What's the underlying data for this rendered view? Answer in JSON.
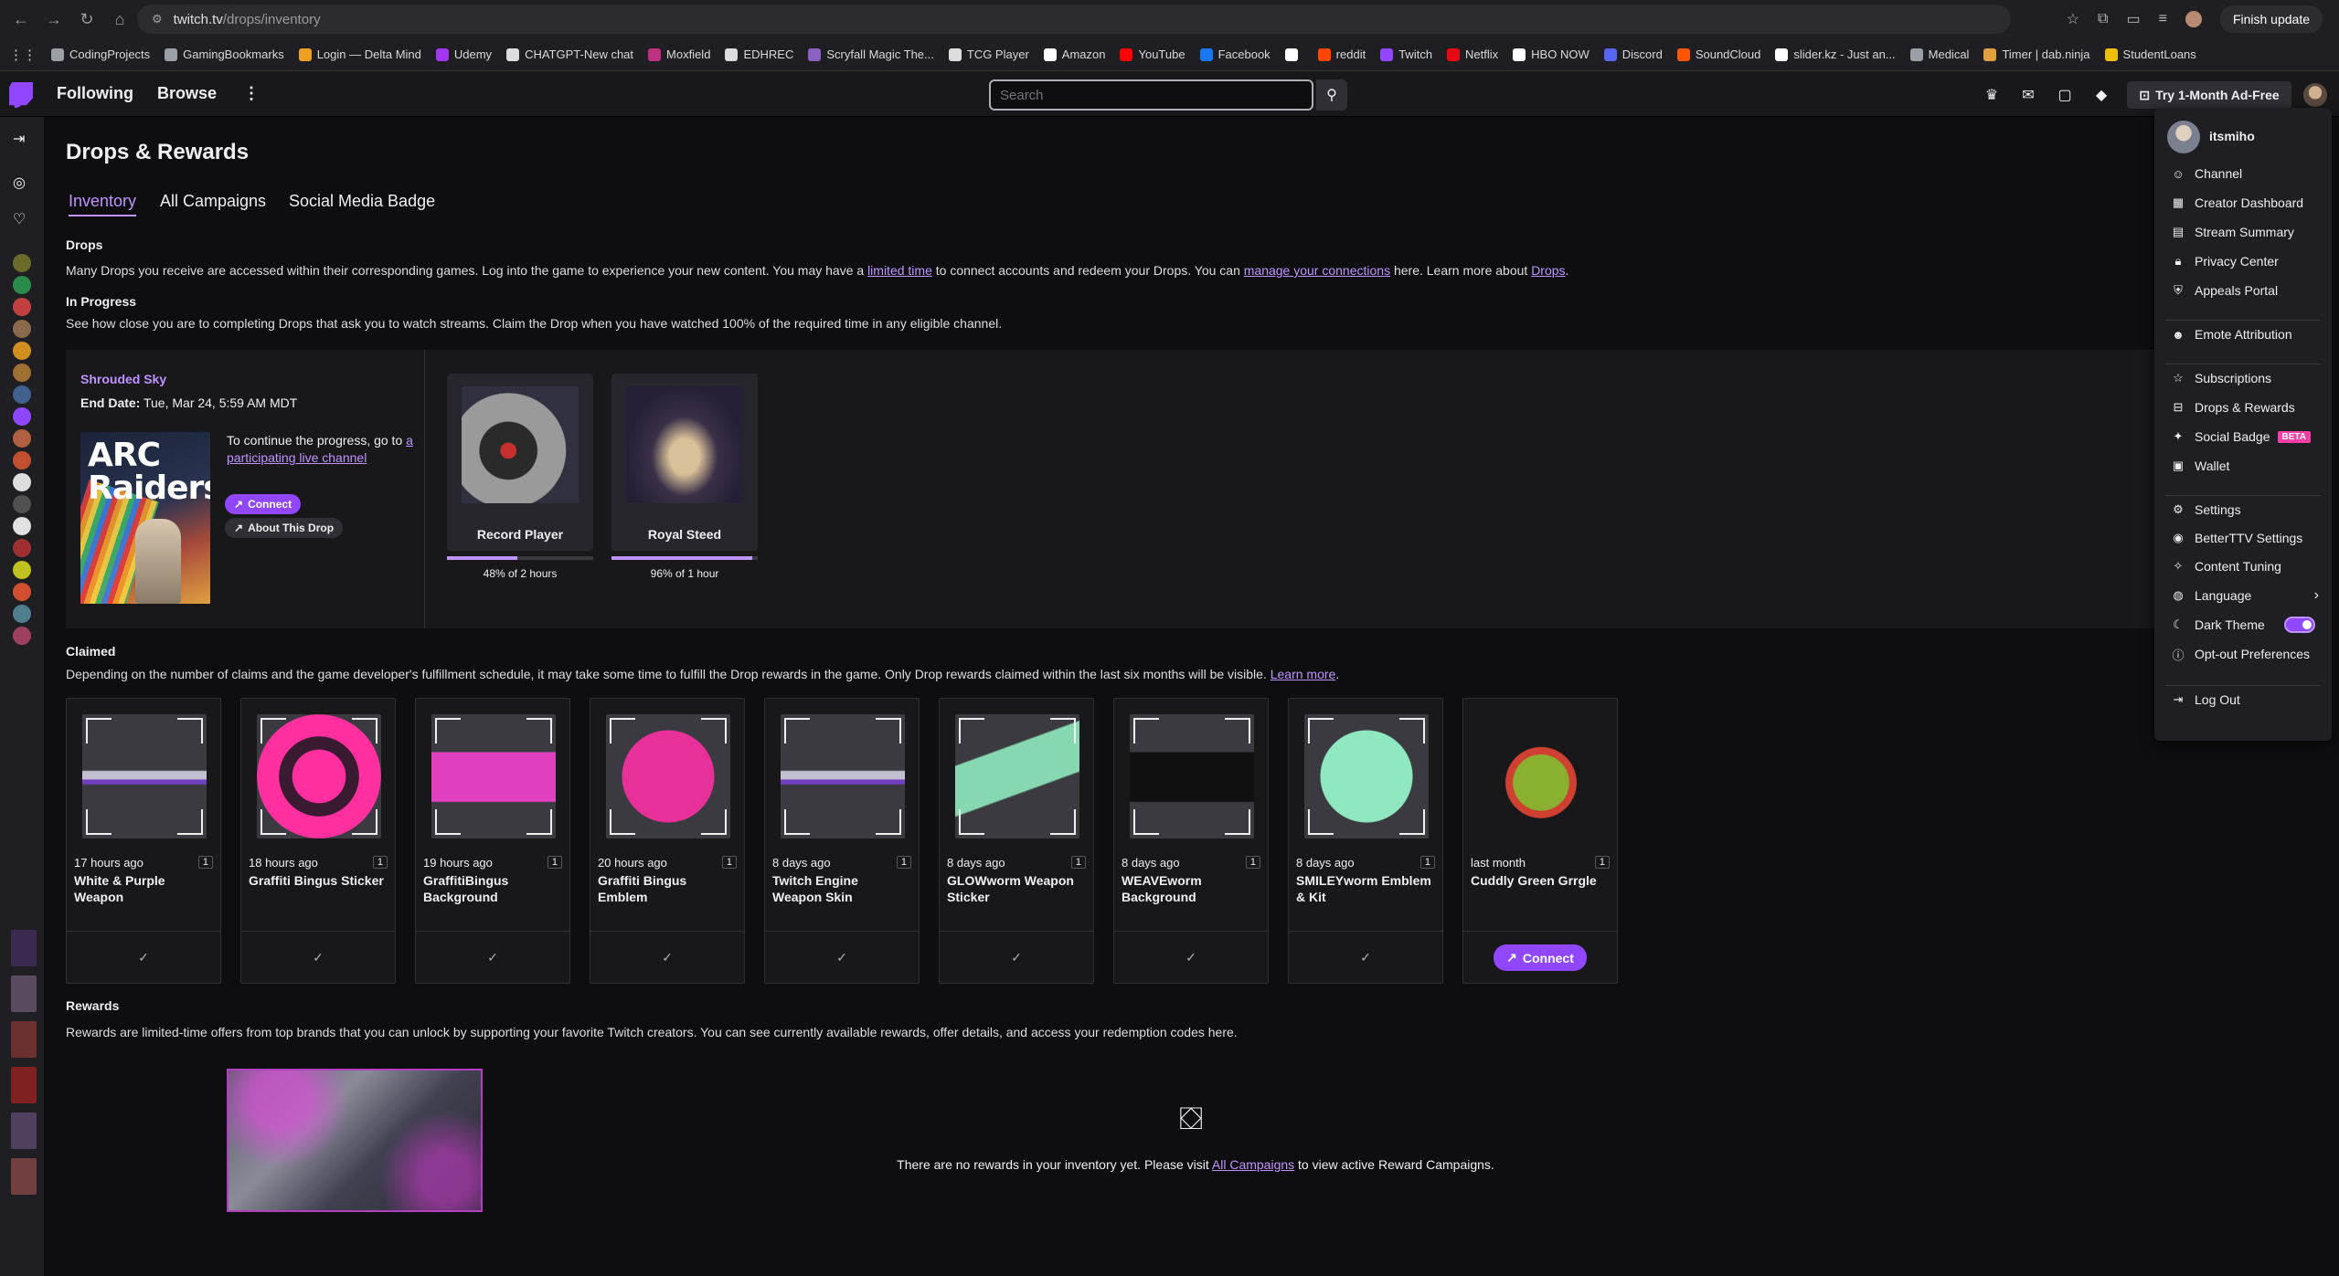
{
  "browser": {
    "url_host": "twitch.tv",
    "url_path": "/drops/inventory",
    "finish_update_label": "Finish update",
    "bookmarks": [
      {
        "label": "CodingProjects",
        "color": "#9aa0a6"
      },
      {
        "label": "GamingBookmarks",
        "color": "#9aa0a6"
      },
      {
        "label": "Login — Delta Mind",
        "color": "#f0a020"
      },
      {
        "label": "Udemy",
        "color": "#a435f0"
      },
      {
        "label": "CHATGPT-New chat",
        "color": "#dddddd"
      },
      {
        "label": "Moxfield",
        "color": "#c03080"
      },
      {
        "label": "EDHREC",
        "color": "#dddddd"
      },
      {
        "label": "Scryfall Magic The...",
        "color": "#8a60c0"
      },
      {
        "label": "TCG Player",
        "color": "#dddddd"
      },
      {
        "label": "Amazon",
        "color": "#ffffff"
      },
      {
        "label": "YouTube",
        "color": "#ff0000"
      },
      {
        "label": "Facebook",
        "color": "#1877f2"
      },
      {
        "label": "",
        "color": "#ffffff"
      },
      {
        "label": "reddit",
        "color": "#ff4500"
      },
      {
        "label": "Twitch",
        "color": "#9147ff"
      },
      {
        "label": "Netflix",
        "color": "#e50914"
      },
      {
        "label": "HBO NOW",
        "color": "#ffffff"
      },
      {
        "label": "Discord",
        "color": "#5865f2"
      },
      {
        "label": "SoundCloud",
        "color": "#ff5500"
      },
      {
        "label": "slider.kz - Just an...",
        "color": "#ffffff"
      },
      {
        "label": "Medical",
        "color": "#9aa0a6"
      },
      {
        "label": "Timer | dab.ninja",
        "color": "#e0a040"
      },
      {
        "label": "StudentLoans",
        "color": "#f0c000"
      }
    ]
  },
  "topnav": {
    "following": "Following",
    "browse": "Browse",
    "search_placeholder": "Search",
    "adfree_label": "Try 1-Month Ad-Free"
  },
  "page": {
    "title": "Drops & Rewards",
    "tabs": [
      "Inventory",
      "All Campaigns",
      "Social Media Badge"
    ],
    "drops_title": "Drops",
    "drops_text_1": "Many Drops you receive are accessed within their corresponding games. Log into the game to experience your new content. You may have a ",
    "drops_link_1": "limited time",
    "drops_text_2": " to connect accounts and redeem your Drops. You can ",
    "drops_link_2": "manage your connections",
    "drops_text_3": " here. Learn more about ",
    "drops_link_3": "Drops",
    "drops_text_4": ".",
    "inprogress_title": "In Progress",
    "inprogress_text": "See how close you are to completing Drops that ask you to watch streams. Claim the Drop when you have watched 100% of the required time in any eligible channel.",
    "claimed_title": "Claimed",
    "claimed_text": "Depending on the number of claims and the game developer's fulfillment schedule, it may take some time to fulfill the Drop rewards in the game. Only Drop rewards claimed within the last six months will be visible. ",
    "claimed_link": "Learn more",
    "claimed_end": ".",
    "rewards_title": "Rewards",
    "rewards_text": "Rewards are limited-time offers from top brands that you can unlock by supporting your favorite Twitch creators. You can see currently available rewards, offer details, and access your redemption codes here.",
    "empty_text_1": "There are no rewards in your inventory yet. Please visit ",
    "empty_link": "All Campaigns",
    "empty_text_2": " to view active Reward Campaigns."
  },
  "campaign": {
    "name": "Shrouded Sky",
    "end_label": "End Date:",
    "end_value": " Tue, Mar 24, 5:59 AM MDT",
    "game_art_text": "ARC Raiders",
    "continue_text": "To continue the progress, go to ",
    "continue_link": "a participating live channel",
    "connect_label": "Connect",
    "about_label": "About This Drop",
    "drops": [
      {
        "name": "Record Player",
        "progress": 0.48,
        "label": "48% of 2 hours"
      },
      {
        "name": "Royal Steed",
        "progress": 0.96,
        "label": "96% of 1 hour"
      }
    ]
  },
  "claimed": [
    {
      "time": "17 hours ago",
      "count": "1",
      "name": "White & Purple Weapon",
      "icon": "weapon-skin-icon"
    },
    {
      "time": "18 hours ago",
      "count": "1",
      "name": "Graffiti Bingus Sticker",
      "icon": "cat-sticker-icon"
    },
    {
      "time": "19 hours ago",
      "count": "1",
      "name": "GraffitiBingus Background",
      "icon": "background-icon"
    },
    {
      "time": "20 hours ago",
      "count": "1",
      "name": "Graffiti Bingus Emblem",
      "icon": "cat-emblem-icon"
    },
    {
      "time": "8 days ago",
      "count": "1",
      "name": "Twitch Engine Weapon Skin",
      "icon": "weapon-skin-icon"
    },
    {
      "time": "8 days ago",
      "count": "1",
      "name": "GLOWworm Weapon Sticker",
      "icon": "worm-sticker-icon"
    },
    {
      "time": "8 days ago",
      "count": "1",
      "name": "WEAVEworm Background",
      "icon": "background-icon"
    },
    {
      "time": "8 days ago",
      "count": "1",
      "name": "SMILEYworm Emblem & Kit",
      "icon": "smiley-emblem-icon"
    },
    {
      "time": "last month",
      "count": "1",
      "name": "Cuddly Green Grrgle",
      "icon": "creature-icon",
      "action": "Connect"
    }
  ],
  "menu": {
    "username": "itsmiho",
    "items": [
      {
        "label": "Channel",
        "icon": "person-icon"
      },
      {
        "label": "Creator Dashboard",
        "icon": "dashboard-icon"
      },
      {
        "label": "Stream Summary",
        "icon": "summary-icon"
      },
      {
        "label": "Privacy Center",
        "icon": "lock-icon"
      },
      {
        "label": "Appeals Portal",
        "icon": "shield-icon"
      },
      {
        "label": "Emote Attribution",
        "icon": "emote-icon"
      },
      {
        "label": "Subscriptions",
        "icon": "star-icon"
      },
      {
        "label": "Drops & Rewards",
        "icon": "gift-icon"
      },
      {
        "label": "Social Badge",
        "icon": "sparkle-icon",
        "badge": "BETA"
      },
      {
        "label": "Wallet",
        "icon": "wallet-icon"
      },
      {
        "label": "Settings",
        "icon": "gear-icon"
      },
      {
        "label": "BetterTTV Settings",
        "icon": "bttv-icon"
      },
      {
        "label": "Content Tuning",
        "icon": "tuning-icon"
      },
      {
        "label": "Language",
        "icon": "globe-icon"
      },
      {
        "label": "Dark Theme",
        "icon": "moon-icon"
      },
      {
        "label": "Opt-out Preferences",
        "icon": "info-icon"
      },
      {
        "label": "Log Out",
        "icon": "logout-icon"
      }
    ]
  },
  "colors": {
    "accent": "#9147ff",
    "link": "#bf94ff",
    "background": "#0e0e10"
  }
}
